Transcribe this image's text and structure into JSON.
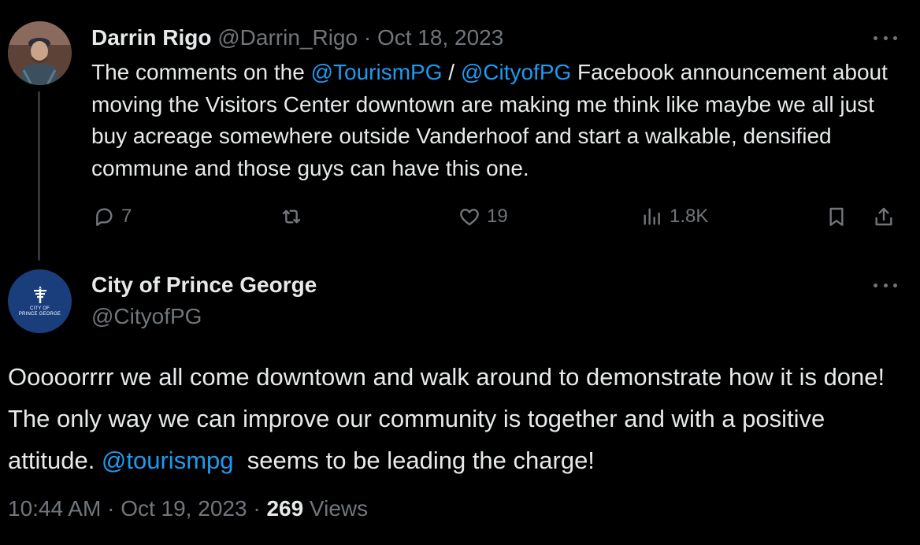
{
  "tweet1": {
    "author_name": "Darrin Rigo",
    "handle": "@Darrin_Rigo",
    "separator": " · ",
    "date": "Oct 18, 2023",
    "body": {
      "part1": "The comments on the ",
      "mention1": "@TourismPG",
      "part2": " / ",
      "mention2": "@CityofPG",
      "part3": " Facebook announcement about moving the Visitors Center downtown are making me think like maybe we all just buy acreage somewhere outside Vanderhoof and start a walkable, densified commune and those guys can have this one."
    },
    "actions": {
      "replies": "7",
      "likes": "19",
      "views": "1.8K"
    }
  },
  "tweet2": {
    "author_name": "City of Prince George",
    "handle": "@CityofPG",
    "avatar_logo": {
      "line1": "CITY OF",
      "line2": "PRINCE GEORGE"
    },
    "body": {
      "part1": "Ooooorrrr we all come downtown and walk around to demonstrate how it is done! The only way we can improve our community is together and with a positive attitude. ",
      "mention1": "@tourismpg",
      "part2": "  seems to be leading the charge!"
    },
    "time": "10:44 AM",
    "separator": " · ",
    "date": "Oct 19, 2023",
    "separator2": " · ",
    "views_count": "269",
    "views_label": " Views"
  },
  "colors": {
    "background": "#000000",
    "text": "#e7e9ea",
    "secondary": "#71767b",
    "link": "#1d9bf0",
    "logo_bg": "#1a3d7c"
  }
}
